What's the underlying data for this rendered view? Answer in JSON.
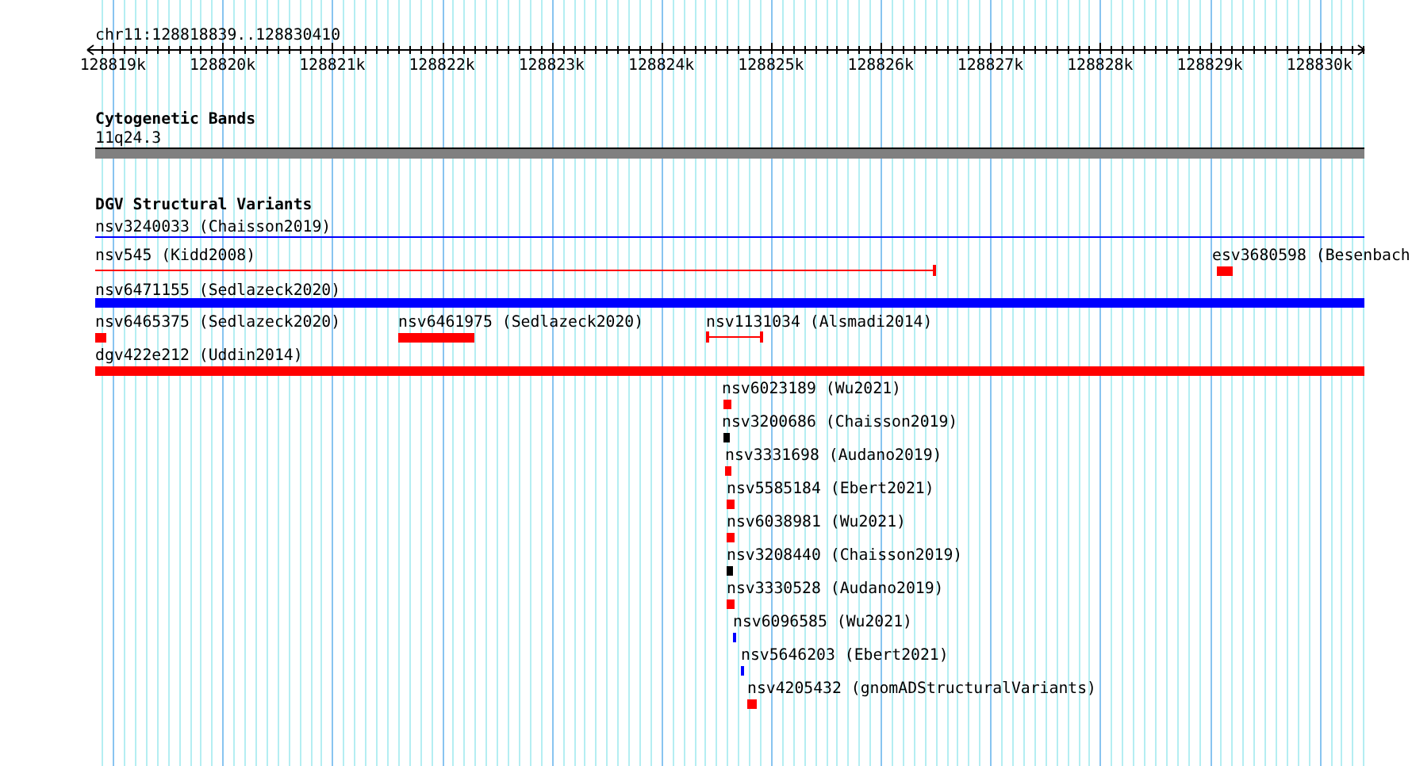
{
  "ruler": {
    "location": "chr11:128818839..128830410",
    "ticks": [
      "128819k",
      "128820k",
      "128821k",
      "128822k",
      "128823k",
      "128824k",
      "128825k",
      "128826k",
      "128827k",
      "128828k",
      "128829k",
      "128830k"
    ]
  },
  "cytoband_track": {
    "title": "Cytogenetic Bands",
    "band": "11q24.3"
  },
  "variant_track": {
    "title": "DGV Structural Variants",
    "features": [
      {
        "label": "nsv3240033 (Chaisson2019)",
        "kind": "line",
        "color": "#0000ff"
      },
      {
        "label": "nsv545 (Kidd2008)",
        "kind": "capped-line",
        "color": "#ff0000"
      },
      {
        "label": "esv3680598 (Besenbach",
        "kind": "bar",
        "color": "#ff0000"
      },
      {
        "label": "nsv6471155 (Sedlazeck2020)",
        "kind": "bar",
        "color": "#0000ff"
      },
      {
        "label": "nsv6465375 (Sedlazeck2020)",
        "kind": "bar",
        "color": "#ff0000"
      },
      {
        "label": "nsv6461975 (Sedlazeck2020)",
        "kind": "bar",
        "color": "#ff0000"
      },
      {
        "label": "nsv1131034 (Alsmadi2014)",
        "kind": "interval",
        "color": "#ff0000"
      },
      {
        "label": "dgv422e212 (Uddin2014)",
        "kind": "bar",
        "color": "#ff0000"
      },
      {
        "label": "nsv6023189 (Wu2021)",
        "kind": "bar",
        "color": "#ff0000"
      },
      {
        "label": "nsv3200686 (Chaisson2019)",
        "kind": "bar",
        "color": "#000000"
      },
      {
        "label": "nsv3331698 (Audano2019)",
        "kind": "bar",
        "color": "#ff0000"
      },
      {
        "label": "nsv5585184 (Ebert2021)",
        "kind": "bar",
        "color": "#ff0000"
      },
      {
        "label": "nsv6038981 (Wu2021)",
        "kind": "bar",
        "color": "#ff0000"
      },
      {
        "label": "nsv3208440 (Chaisson2019)",
        "kind": "bar",
        "color": "#000000"
      },
      {
        "label": "nsv3330528 (Audano2019)",
        "kind": "bar",
        "color": "#ff0000"
      },
      {
        "label": "nsv6096585 (Wu2021)",
        "kind": "bar",
        "color": "#0000ff"
      },
      {
        "label": "nsv5646203 (Ebert2021)",
        "kind": "bar",
        "color": "#0000ff"
      },
      {
        "label": "nsv4205432 (gnomADStructuralVariants)",
        "kind": "bar",
        "color": "#ff0000"
      }
    ]
  }
}
